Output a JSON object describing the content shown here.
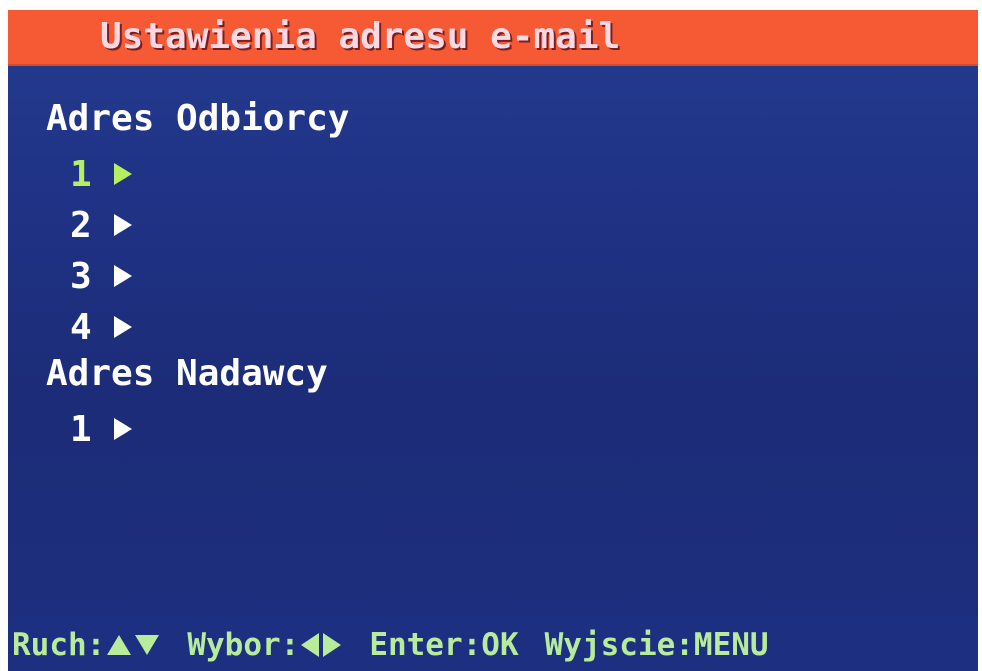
{
  "title": "Ustawienia adresu e-mail",
  "recipient": {
    "label": "Adres Odbiorcy",
    "slots": [
      "1",
      "2",
      "3",
      "4"
    ],
    "selected_index": 0
  },
  "sender": {
    "label": "Adres Nadawcy",
    "slots": [
      "1"
    ]
  },
  "help": {
    "move_label": "Ruch:",
    "select_label": "Wybor:",
    "enter_label": "Enter:OK",
    "exit_label": "Wyjscie:MENU"
  },
  "icons": {
    "slot_arrow": "play-triangle-icon",
    "move": [
      "triangle-up-icon",
      "triangle-down-icon"
    ],
    "select": [
      "triangle-left-icon",
      "triangle-right-icon"
    ]
  },
  "colors": {
    "title_bar": "#f55a34",
    "title_text": "#fbd8e2",
    "background": "#1d2f80",
    "selected": "#b6f061",
    "help_text": "#b8ec9a"
  }
}
